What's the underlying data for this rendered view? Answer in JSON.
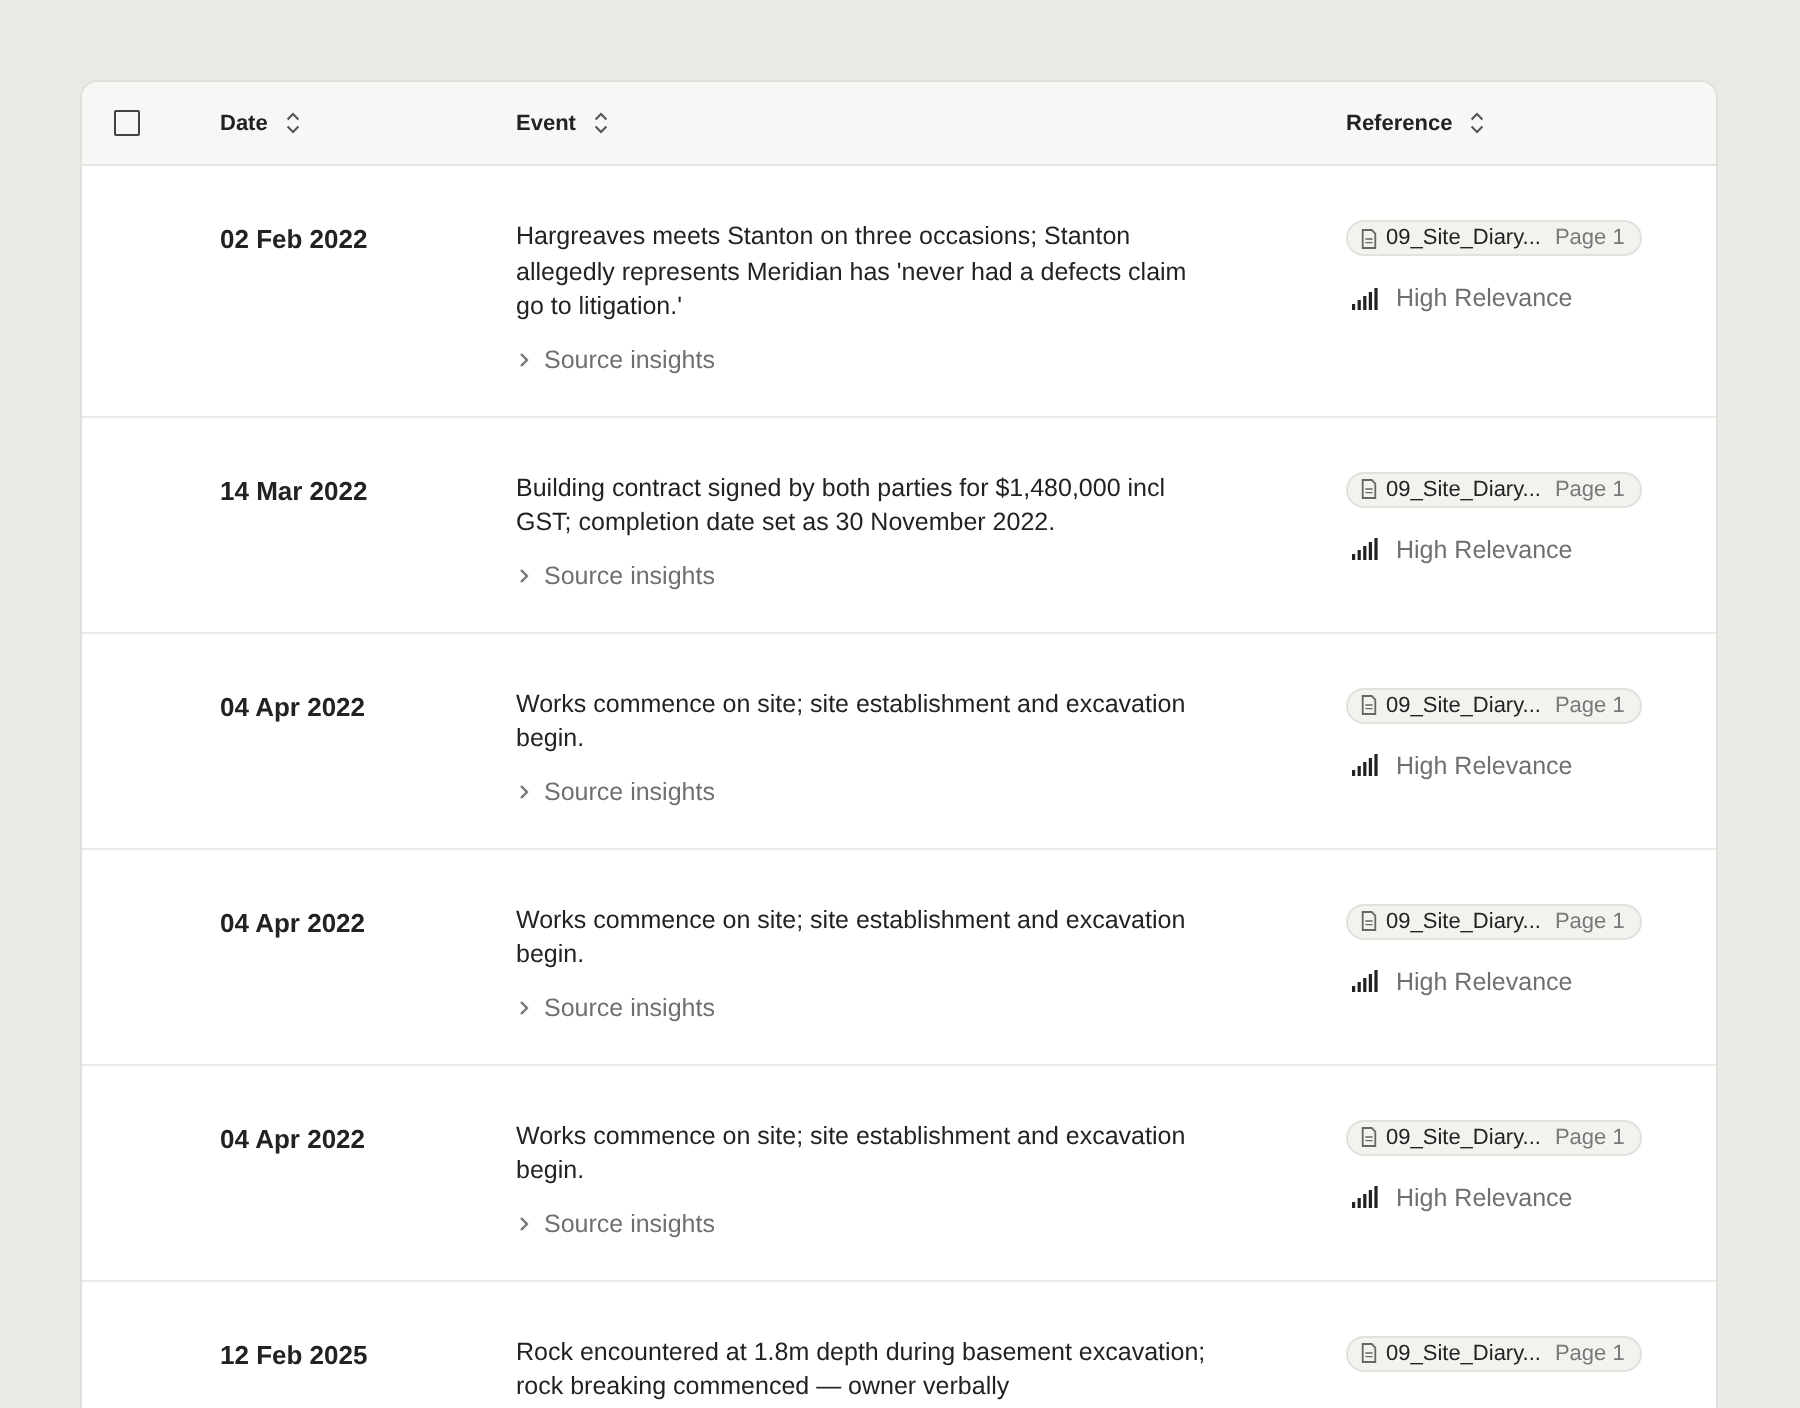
{
  "table": {
    "select_all": {
      "checked": false
    },
    "columns": [
      {
        "label": "Date"
      },
      {
        "label": "Event"
      },
      {
        "label": "Reference"
      }
    ],
    "rows": [
      {
        "date": "02 Feb 2022",
        "event": "Hargreaves meets Stanton on three occasions; Stanton allegedly represents Meridian has 'never had a defects claim go to litigation.'",
        "insights": "Source insights",
        "file": "09_Site_Diary...",
        "page": "Page 1",
        "relevance": "High Relevance"
      },
      {
        "date": "14 Mar 2022",
        "event": "Building contract signed by both parties for $1,480,000 incl GST; completion date set as 30 November 2022.",
        "insights": "Source insights",
        "file": "09_Site_Diary...",
        "page": "Page 1",
        "relevance": "High Relevance"
      },
      {
        "date": "04 Apr 2022",
        "event": "Works commence on site; site establishment and excavation begin.",
        "insights": "Source insights",
        "file": "09_Site_Diary...",
        "page": "Page 1",
        "relevance": "High Relevance"
      },
      {
        "date": "04 Apr 2022",
        "event": "Works commence on site; site establishment and excavation begin.",
        "insights": "Source insights",
        "file": "09_Site_Diary...",
        "page": "Page 1",
        "relevance": "High Relevance"
      },
      {
        "date": "04 Apr 2022",
        "event": "Works commence on site; site establishment and excavation begin.",
        "insights": "Source insights",
        "file": "09_Site_Diary...",
        "page": "Page 1",
        "relevance": "High Relevance"
      },
      {
        "date": "12 Feb 2025",
        "event": "Rock encountered at 1.8m depth during basement excavation; rock breaking commenced — owner verbally",
        "file": "09_Site_Diary...",
        "page": "Page 1"
      }
    ]
  }
}
